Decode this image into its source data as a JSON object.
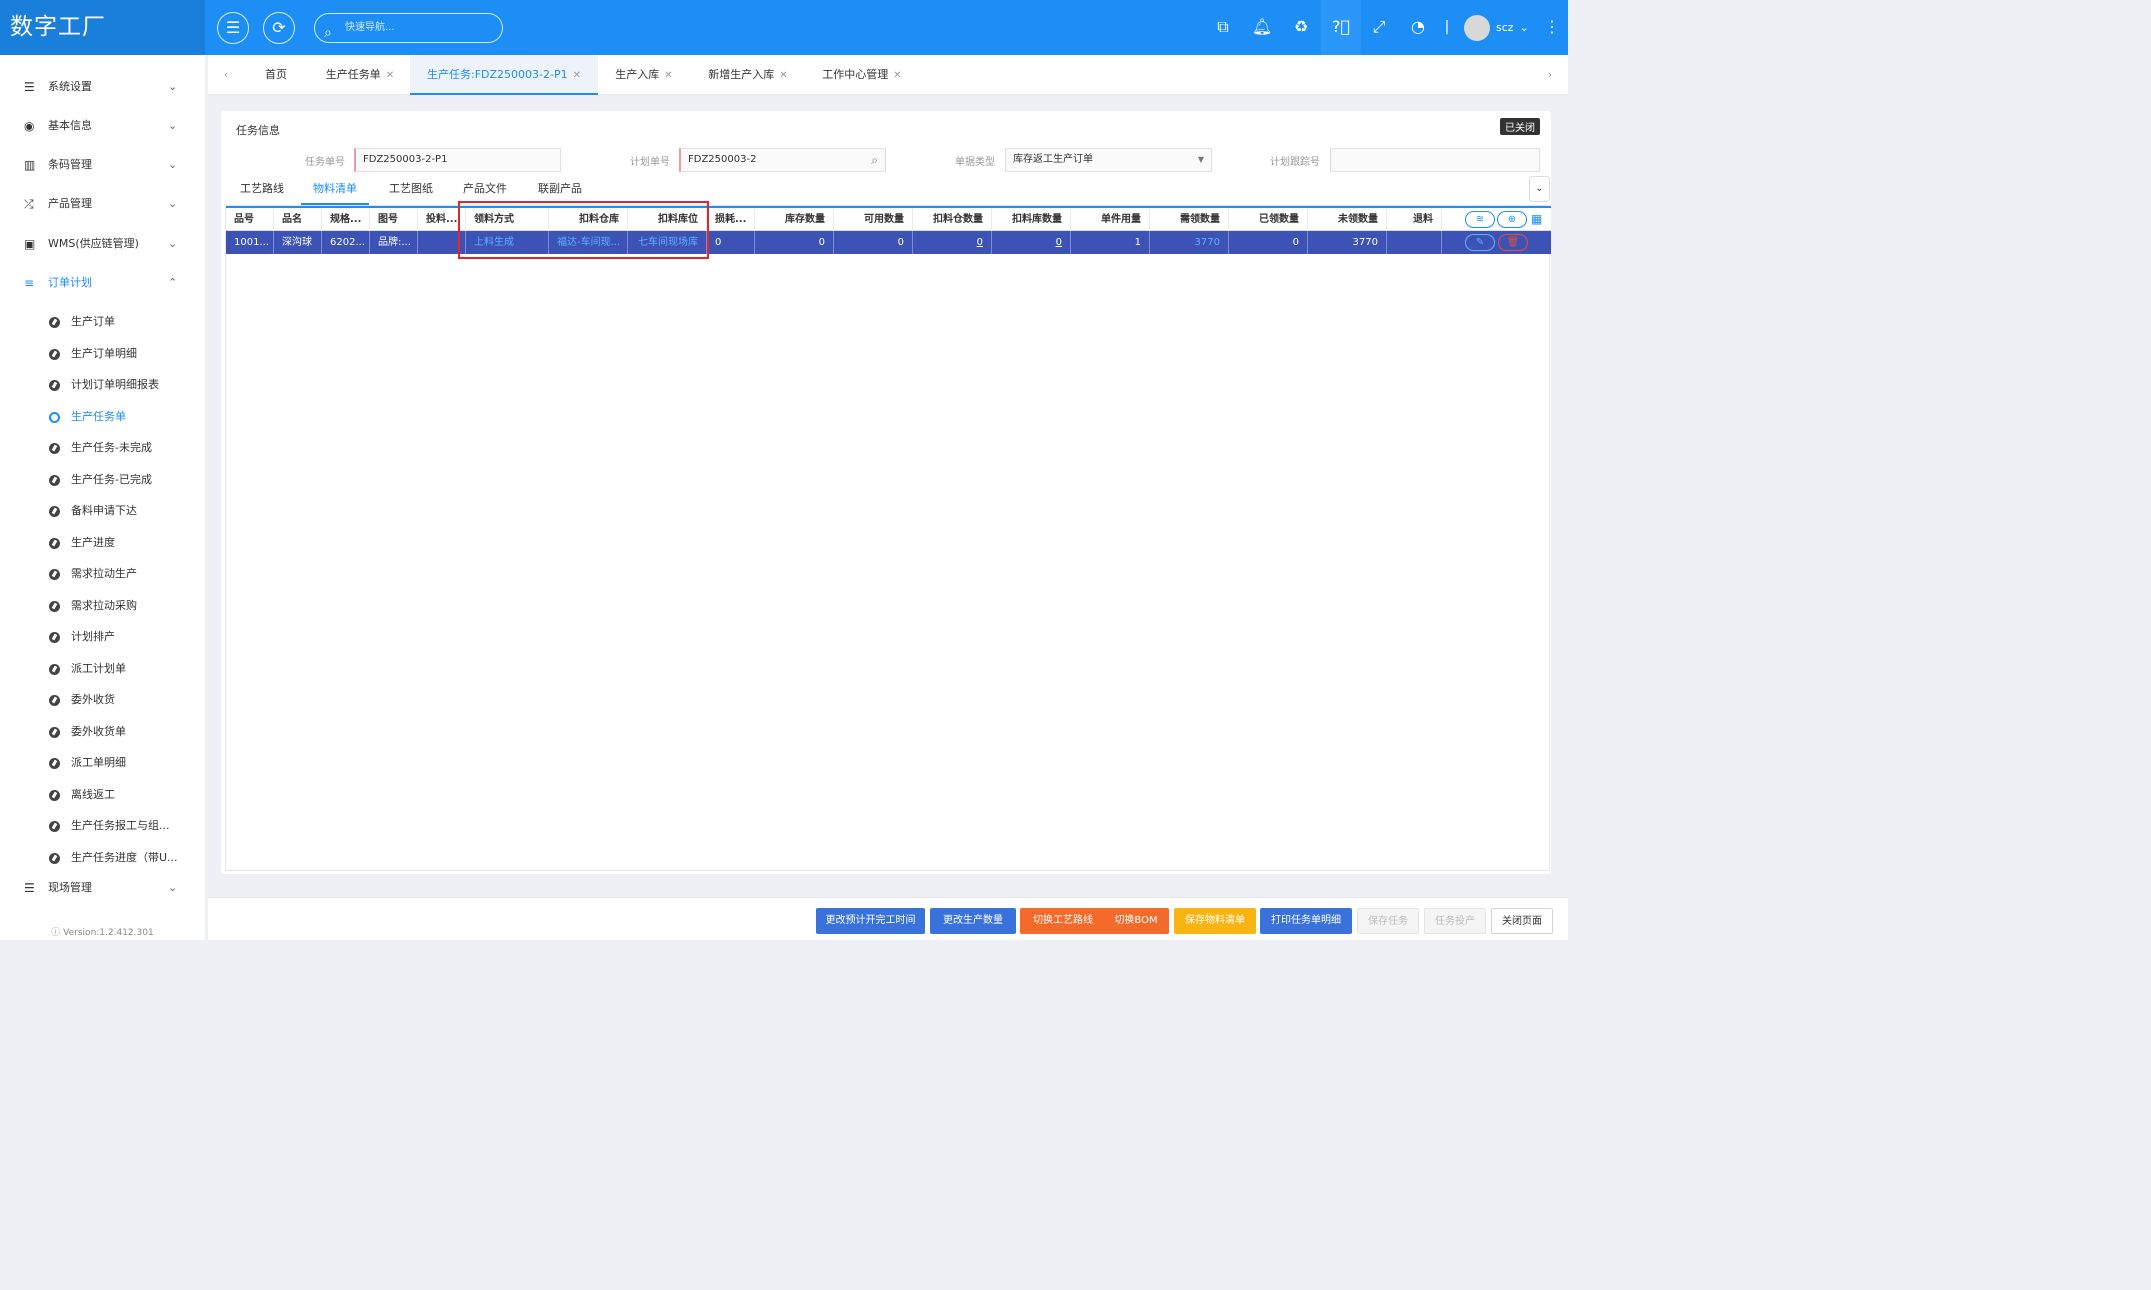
{
  "app": {
    "title": "数字工厂"
  },
  "topbar": {
    "search_placeholder": "快速导航...",
    "user_name": "scz",
    "icons": [
      "menu-icon",
      "refresh-icon",
      "window-icon",
      "bell-icon",
      "recycle-icon",
      "help-icon",
      "fullscreen-icon",
      "dashboard-icon",
      "more-icon"
    ]
  },
  "sidebar": {
    "menus": [
      {
        "label": "系统设置",
        "icon": "list-icon"
      },
      {
        "label": "基本信息",
        "icon": "compass-icon"
      },
      {
        "label": "条码管理",
        "icon": "barcode-icon"
      },
      {
        "label": "产品管理",
        "icon": "shuffle-icon"
      },
      {
        "label": "WMS(供应链管理)",
        "icon": "monitor-icon"
      },
      {
        "label": "订单计划",
        "icon": "sliders-icon"
      }
    ],
    "sub_items": [
      "生产订单",
      "生产订单明细",
      "计划订单明细报表",
      "生产任务单",
      "生产任务-未完成",
      "生产任务-已完成",
      "备料申请下达",
      "生产进度",
      "需求拉动生产",
      "需求拉动采购",
      "计划排产",
      "派工计划单",
      "委外收货",
      "委外收货单",
      "派工单明细",
      "离线返工",
      "生产任务报工与组...",
      "生产任务进度（带U..."
    ],
    "active_sub": "生产任务单",
    "next_menu": "现场管理",
    "version": "Version:1.2.412.301"
  },
  "tabs": [
    "首页",
    "生产任务单",
    "生产任务:FDZ250003-2-P1",
    "生产入库",
    "新增生产入库",
    "工作中心管理"
  ],
  "form": {
    "section_title": "任务信息",
    "closed_badge": "已关闭",
    "fields": [
      {
        "label": "任务单号",
        "value": "FDZ250003-2-P1"
      },
      {
        "label": "计划单号",
        "value": "FDZ250003-2"
      },
      {
        "label": "单据类型",
        "value": "库存返工生产订单"
      },
      {
        "label": "计划跟踪号",
        "value": ""
      }
    ]
  },
  "subtabs": [
    "工艺路线",
    "物料清单",
    "工艺图纸",
    "产品文件",
    "联副产品"
  ],
  "grid": {
    "columns": [
      "品号",
      "品名",
      "规格...",
      "图号",
      "投料...",
      "领料方式",
      "扣料仓库",
      "扣料库位",
      "损耗...",
      "库存数量",
      "可用数量",
      "扣料仓数量",
      "扣料库数量",
      "单件用量",
      "需领数量",
      "已领数量",
      "未领数量",
      "退料"
    ],
    "rows": [
      [
        "1001...",
        "深沟球",
        "6202...",
        "品牌:...",
        "",
        "上料生成",
        "福达-车间现...",
        "七车间现场库",
        "0",
        "0",
        "0",
        "0",
        "0",
        "1",
        "3770",
        "0",
        "3770",
        ""
      ]
    ]
  },
  "actions": [
    "更改预计开完工时间",
    "更改生产数量",
    "切换工艺路线",
    "切换BOM",
    "保存物料清单",
    "打印任务单明细",
    "保存任务",
    "任务投产",
    "关闭页面"
  ]
}
